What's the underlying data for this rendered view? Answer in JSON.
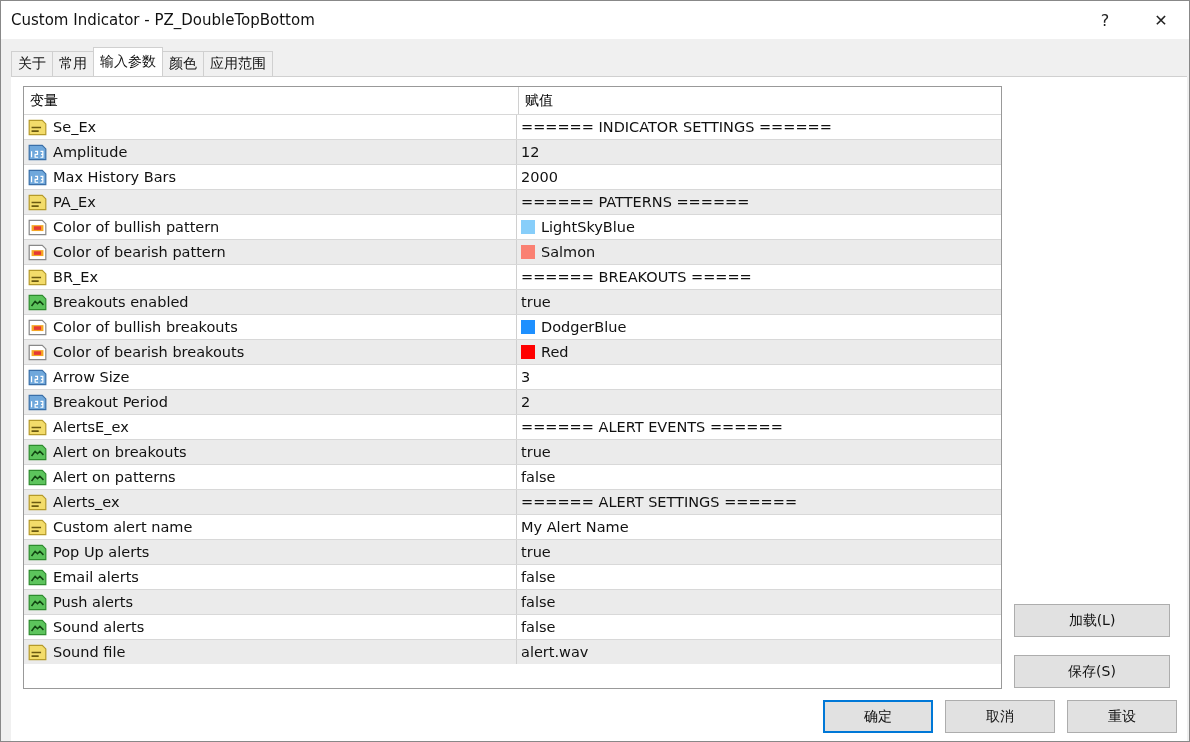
{
  "window": {
    "title": "Custom Indicator - PZ_DoubleTopBottom",
    "help": "?",
    "close": "✕"
  },
  "tabs": [
    {
      "label": "关于",
      "selected": false
    },
    {
      "label": "常用",
      "selected": false
    },
    {
      "label": "输入参数",
      "selected": true
    },
    {
      "label": "颜色",
      "selected": false
    },
    {
      "label": "应用范围",
      "selected": false
    }
  ],
  "table": {
    "columns": [
      "变量",
      "赋值"
    ],
    "rows": [
      {
        "kind": "string",
        "name": "Se_Ex",
        "value": "====== INDICATOR SETTINGS ======"
      },
      {
        "kind": "int",
        "name": "Amplitude",
        "value": "12"
      },
      {
        "kind": "int",
        "name": "Max History Bars",
        "value": "2000"
      },
      {
        "kind": "string",
        "name": "PA_Ex",
        "value": "====== PATTERNS ======"
      },
      {
        "kind": "color",
        "name": "Color of bullish pattern",
        "value": "LightSkyBlue",
        "color": "#87cefa"
      },
      {
        "kind": "color",
        "name": "Color of bearish pattern",
        "value": "Salmon",
        "color": "#fa8072"
      },
      {
        "kind": "string",
        "name": "BR_Ex",
        "value": "====== BREAKOUTS ====="
      },
      {
        "kind": "bool",
        "name": "Breakouts enabled",
        "value": "true"
      },
      {
        "kind": "color",
        "name": "Color of bullish breakouts",
        "value": "DodgerBlue",
        "color": "#1e90ff"
      },
      {
        "kind": "color",
        "name": "Color of bearish breakouts",
        "value": "Red",
        "color": "#ff0000"
      },
      {
        "kind": "int",
        "name": "Arrow Size",
        "value": "3"
      },
      {
        "kind": "int",
        "name": "Breakout Period",
        "value": "2"
      },
      {
        "kind": "string",
        "name": "AlertsE_ex",
        "value": "====== ALERT EVENTS ======"
      },
      {
        "kind": "bool",
        "name": "Alert on breakouts",
        "value": "true"
      },
      {
        "kind": "bool",
        "name": "Alert on patterns",
        "value": "false"
      },
      {
        "kind": "string",
        "name": "Alerts_ex",
        "value": "====== ALERT SETTINGS ======"
      },
      {
        "kind": "string",
        "name": "Custom alert name",
        "value": "My Alert Name"
      },
      {
        "kind": "bool",
        "name": "Pop Up alerts",
        "value": "true"
      },
      {
        "kind": "bool",
        "name": "Email alerts",
        "value": "false"
      },
      {
        "kind": "bool",
        "name": "Push alerts",
        "value": "false"
      },
      {
        "kind": "bool",
        "name": "Sound alerts",
        "value": "false"
      },
      {
        "kind": "string",
        "name": "Sound file",
        "value": "alert.wav"
      }
    ]
  },
  "side_buttons": [
    "加载(L)",
    "保存(S)"
  ],
  "buttons": [
    {
      "label": "确定",
      "selected": true
    },
    {
      "label": "取消",
      "selected": false
    },
    {
      "label": "重设",
      "selected": false
    }
  ]
}
